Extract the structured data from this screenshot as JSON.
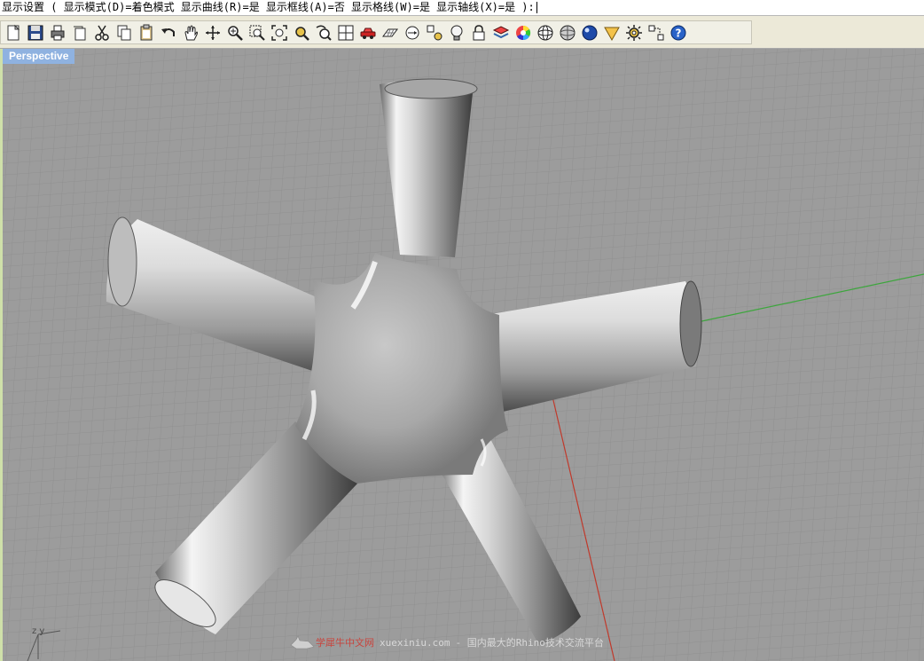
{
  "command": {
    "text": "显示设置 ( 显示模式(D)=着色模式  显示曲线(R)=是  显示框线(A)=否  显示格线(W)=是  显示轴线(X)=是 ):"
  },
  "viewport": {
    "title": "Perspective",
    "axis_label": "z y"
  },
  "watermark": {
    "brand": "学犀牛中文网",
    "url": "xuexiniu.com",
    "tagline": " - 国内最大的Rhino技术交流平台"
  },
  "toolbar": [
    {
      "name": "new-icon",
      "label": "新建"
    },
    {
      "name": "save-icon",
      "label": "保存"
    },
    {
      "name": "print-icon",
      "label": "打印"
    },
    {
      "name": "export-icon",
      "label": "导出"
    },
    {
      "name": "cut-icon",
      "label": "剪切"
    },
    {
      "name": "copy-icon",
      "label": "复制"
    },
    {
      "name": "paste-icon",
      "label": "粘贴"
    },
    {
      "name": "undo-icon",
      "label": "复原"
    },
    {
      "name": "pan-hand-icon",
      "label": "平移"
    },
    {
      "name": "rotate-view-icon",
      "label": "旋转视图"
    },
    {
      "name": "zoom-dynamic-icon",
      "label": "动态缩放"
    },
    {
      "name": "zoom-window-icon",
      "label": "框选缩放"
    },
    {
      "name": "zoom-extents-icon",
      "label": "缩放至最大范围"
    },
    {
      "name": "zoom-selected-icon",
      "label": "缩放至选取物件"
    },
    {
      "name": "undo-view-icon",
      "label": "复原视图"
    },
    {
      "name": "four-viewports-icon",
      "label": "四个视图"
    },
    {
      "name": "car-icon",
      "label": "设置工作视窗"
    },
    {
      "name": "grid-plane-icon",
      "label": "工作平面"
    },
    {
      "name": "camera-target-icon",
      "label": "相机"
    },
    {
      "name": "osnap-icon",
      "label": "物件锁点"
    },
    {
      "name": "light-bulb-icon",
      "label": "灯光"
    },
    {
      "name": "lock-icon",
      "label": "锁定"
    },
    {
      "name": "layer-icon",
      "label": "图层"
    },
    {
      "name": "color-wheel-icon",
      "label": "颜色"
    },
    {
      "name": "wireframe-sphere-icon",
      "label": "线框模式"
    },
    {
      "name": "shaded-sphere-icon",
      "label": "着色模式"
    },
    {
      "name": "render-sphere-icon",
      "label": "渲染"
    },
    {
      "name": "render-preview-icon",
      "label": "渲染预览"
    },
    {
      "name": "options-gear-icon",
      "label": "选项"
    },
    {
      "name": "toolbar-layout-icon",
      "label": "工具列配置"
    },
    {
      "name": "help-icon",
      "label": "说明"
    }
  ],
  "colors": {
    "viewport_bg": "#9c9c9c",
    "grid_line": "#8f8f8f",
    "grid_major": "#858585",
    "axis_x": "#c0392b",
    "axis_y": "#3da63d",
    "title_bg": "#8fb2e0",
    "left_edge": "#cfe0a9"
  }
}
